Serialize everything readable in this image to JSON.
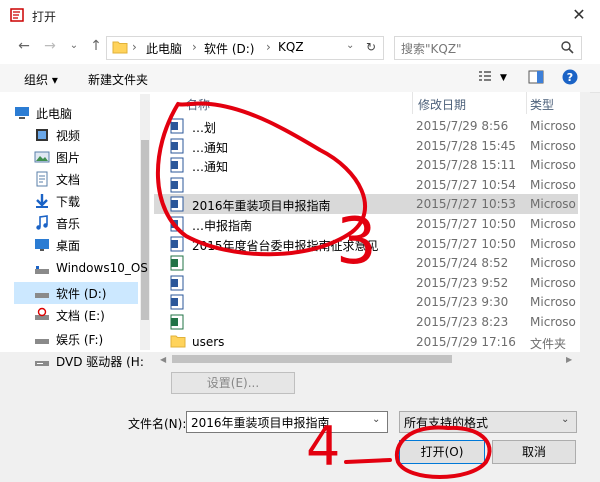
{
  "window": {
    "title": "打开"
  },
  "nav": {
    "breadcrumb": [
      "此电脑",
      "软件 (D:)",
      "KQZ"
    ],
    "search_placeholder": "搜索\"KQZ\""
  },
  "toolbar": {
    "organize": "组织 ▾",
    "new_folder": "新建文件夹"
  },
  "sidebar": {
    "items": [
      {
        "label": "此电脑",
        "icon": "pc-icon"
      },
      {
        "label": "视频",
        "icon": "video-folder-icon"
      },
      {
        "label": "图片",
        "icon": "pictures-folder-icon"
      },
      {
        "label": "文档",
        "icon": "documents-folder-icon"
      },
      {
        "label": "下载",
        "icon": "download-icon"
      },
      {
        "label": "音乐",
        "icon": "music-icon"
      },
      {
        "label": "桌面",
        "icon": "desktop-icon"
      },
      {
        "label": "Windows10_OS",
        "icon": "drive-icon"
      },
      {
        "label": "软件 (D:)",
        "icon": "drive-icon"
      },
      {
        "label": "文档 (E:)",
        "icon": "drive-icon"
      },
      {
        "label": "娱乐 (F:)",
        "icon": "drive-icon"
      },
      {
        "label": "DVD 驱动器 (H:",
        "icon": "dvd-icon"
      }
    ]
  },
  "columns": {
    "name": "名称",
    "date": "修改日期",
    "type": "类型"
  },
  "files": [
    {
      "name": "…划",
      "date": "2015/7/29 8:56",
      "type": "Microso"
    },
    {
      "name": "…通知",
      "date": "2015/7/28 15:45",
      "type": "Microso"
    },
    {
      "name": "…通知",
      "date": "2015/7/28 15:11",
      "type": "Microso"
    },
    {
      "name": "",
      "date": "2015/7/27 10:54",
      "type": "Microso"
    },
    {
      "name": "2016年重装项目申报指南",
      "date": "2015/7/27 10:53",
      "type": "Microso"
    },
    {
      "name": "…申报指南",
      "date": "2015/7/27 10:50",
      "type": "Microso"
    },
    {
      "name": "2015年度省台委申报指南征求意见",
      "date": "2015/7/27 10:50",
      "type": "Microso"
    },
    {
      "name": "",
      "date": "2015/7/24 8:52",
      "type": "Microso"
    },
    {
      "name": "",
      "date": "2015/7/23 9:52",
      "type": "Microso"
    },
    {
      "name": "",
      "date": "2015/7/23 9:30",
      "type": "Microso"
    },
    {
      "name": "",
      "date": "2015/7/23 8:23",
      "type": "Microso"
    },
    {
      "name": "users",
      "date": "2015/7/29 17:16",
      "type": "文件夹"
    }
  ],
  "settings_button": "设置(E)...",
  "filename": {
    "label": "文件名(N):",
    "value": "2016年重装项目申报指南"
  },
  "filter": {
    "value": "所有支持的格式"
  },
  "buttons": {
    "open": "打开(O)",
    "cancel": "取消"
  },
  "annotations": {
    "three": "3",
    "four": "4"
  },
  "colors": {
    "selection": "#cce8ff",
    "annotation": "#e3000f"
  }
}
